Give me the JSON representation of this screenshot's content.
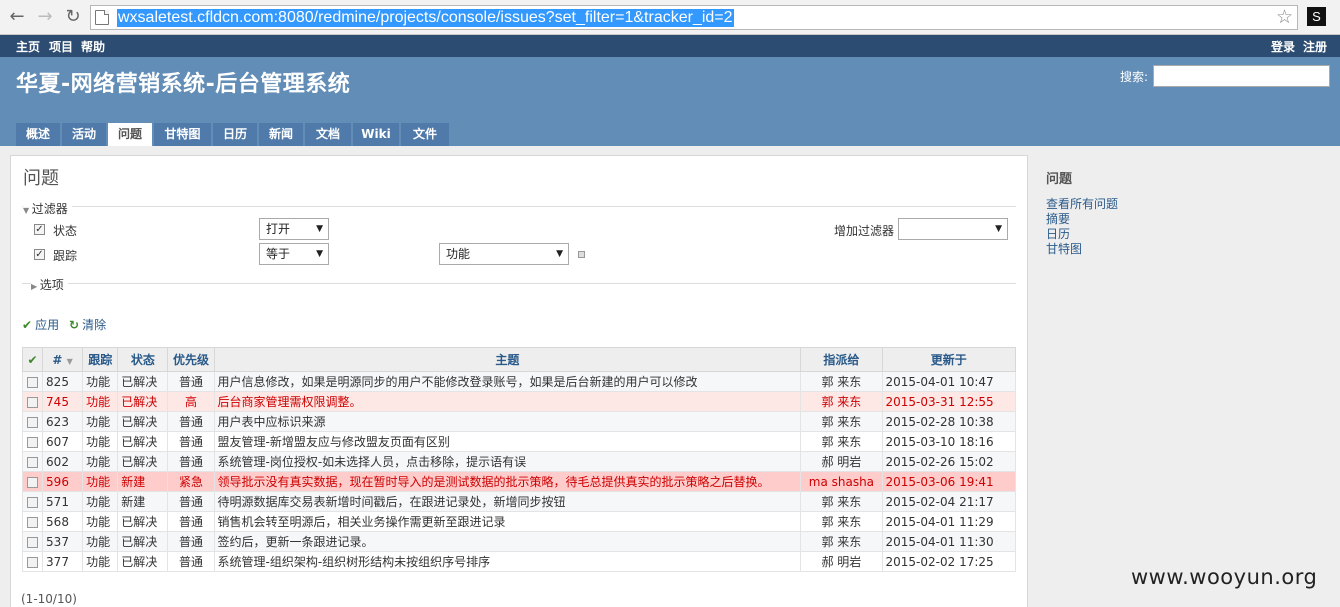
{
  "browser": {
    "url": "wxsaletest.cfldcn.com:8080/redmine/projects/console/issues?set_filter=1&tracker_id=2",
    "ext_letter": "S"
  },
  "topmenu": {
    "home": "主页",
    "projects": "项目",
    "help": "帮助",
    "login": "登录",
    "register": "注册"
  },
  "header": {
    "title": "华夏-网络营销系统-后台管理系统",
    "search_label": "搜索:",
    "tabs": [
      "概述",
      "活动",
      "问题",
      "甘特图",
      "日历",
      "新闻",
      "文档",
      "Wiki",
      "文件"
    ]
  },
  "main": {
    "heading": "问题",
    "filters": {
      "legend": "过滤器",
      "status_label": "状态",
      "status_op": "打开",
      "tracker_label": "跟踪",
      "tracker_op": "等于",
      "tracker_value": "功能",
      "add_filter_label": "增加过滤器"
    },
    "options_legend": "选项",
    "apply": "应用",
    "clear": "清除",
    "columns": [
      "#",
      "跟踪",
      "状态",
      "优先级",
      "主题",
      "指派给",
      "更新于"
    ],
    "rows": [
      {
        "id": "825",
        "tracker": "功能",
        "status": "已解决",
        "priority": "普通",
        "subject": "用户信息修改，如果是明源同步的用户不能修改登录账号，如果是后台新建的用户可以修改",
        "assignee": "郭 来东",
        "updated": "2015-04-01 10:47"
      },
      {
        "id": "745",
        "tracker": "功能",
        "status": "已解决",
        "priority": "高",
        "subject": "后台商家管理需权限调整。",
        "assignee": "郭 来东",
        "updated": "2015-03-31 12:55"
      },
      {
        "id": "623",
        "tracker": "功能",
        "status": "已解决",
        "priority": "普通",
        "subject": "用户表中应标识来源",
        "assignee": "郭 来东",
        "updated": "2015-02-28 10:38"
      },
      {
        "id": "607",
        "tracker": "功能",
        "status": "已解决",
        "priority": "普通",
        "subject": "盟友管理-新增盟友应与修改盟友页面有区别",
        "assignee": "郭 来东",
        "updated": "2015-03-10 18:16"
      },
      {
        "id": "602",
        "tracker": "功能",
        "status": "已解决",
        "priority": "普通",
        "subject": "系统管理-岗位授权-如未选择人员，点击移除，提示语有误",
        "assignee": "郝 明岩",
        "updated": "2015-02-26 15:02"
      },
      {
        "id": "596",
        "tracker": "功能",
        "status": "新建",
        "priority": "紧急",
        "subject": "领导批示没有真实数据，现在暂时导入的是测试数据的批示策略，待毛总提供真实的批示策略之后替换。",
        "assignee": "ma shasha",
        "updated": "2015-03-06 19:41"
      },
      {
        "id": "571",
        "tracker": "功能",
        "status": "新建",
        "priority": "普通",
        "subject": "待明源数据库交易表新增时间戳后，在跟进记录处，新增同步按钮",
        "assignee": "郭 来东",
        "updated": "2015-02-04 21:17"
      },
      {
        "id": "568",
        "tracker": "功能",
        "status": "已解决",
        "priority": "普通",
        "subject": "销售机会转至明源后，相关业务操作需更新至跟进记录",
        "assignee": "郭 来东",
        "updated": "2015-04-01 11:29"
      },
      {
        "id": "537",
        "tracker": "功能",
        "status": "已解决",
        "priority": "普通",
        "subject": "签约后，更新一条跟进记录。",
        "assignee": "郭 来东",
        "updated": "2015-04-01 11:30"
      },
      {
        "id": "377",
        "tracker": "功能",
        "status": "已解决",
        "priority": "普通",
        "subject": "系统管理-组织架构-组织树形结构未按组织序号排序",
        "assignee": "郝 明岩",
        "updated": "2015-02-02 17:25"
      }
    ],
    "pager": "(1-10/10)"
  },
  "sidebar": {
    "heading": "问题",
    "links": [
      "查看所有问题",
      "摘要",
      "日历",
      "甘特图"
    ]
  },
  "watermark": "www.wooyun.org",
  "colors": {
    "header": "#628db6",
    "topmenu": "#2c4c72",
    "tab": "#507aaa",
    "link": "#2a5a8a",
    "urgent_row": "#ffcccc",
    "high_row": "#fee8e6"
  }
}
